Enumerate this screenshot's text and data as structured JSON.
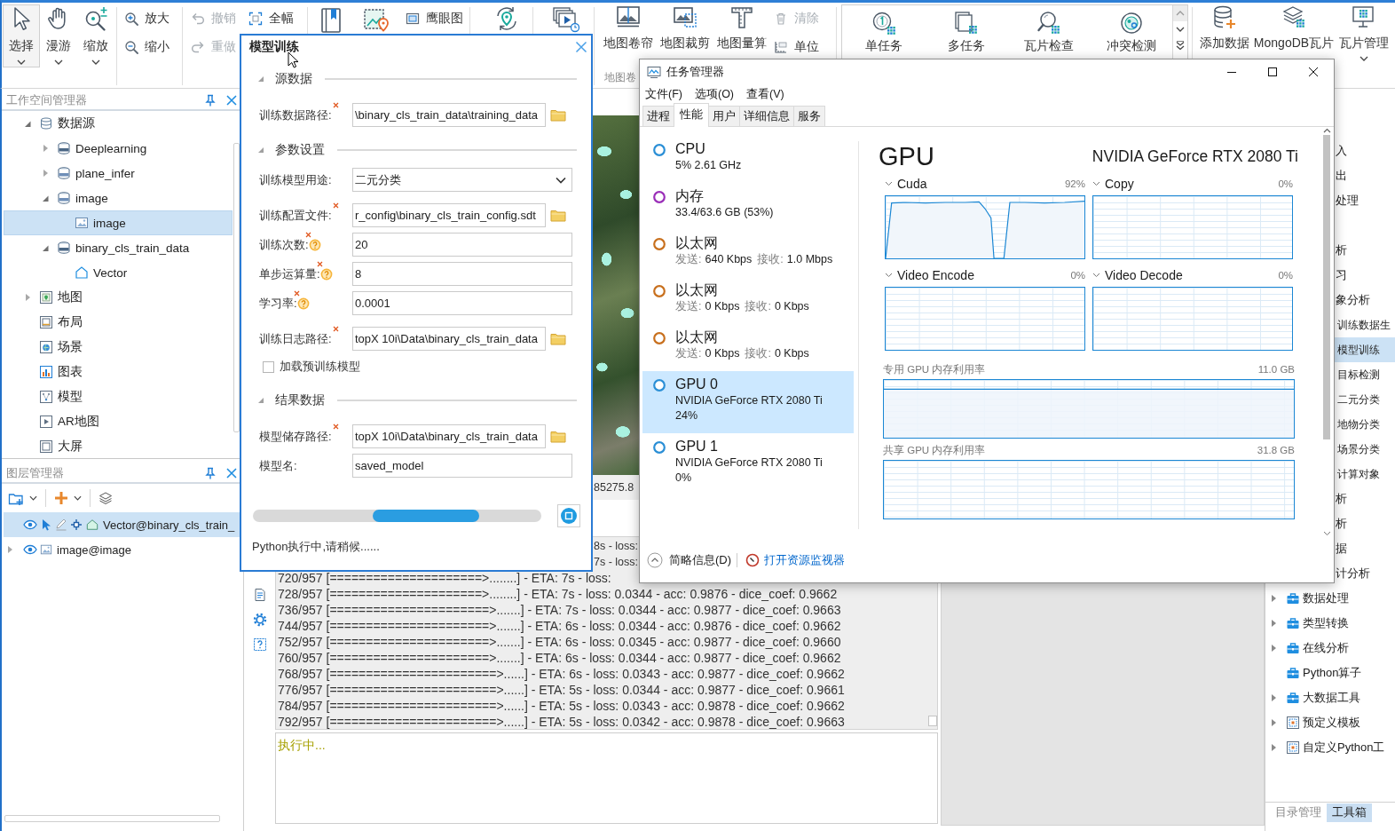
{
  "ribbon": {
    "navigate": [
      {
        "label": "选择",
        "selected": true,
        "dropdown": true
      },
      {
        "label": "漫游",
        "selected": false,
        "dropdown": true
      },
      {
        "label": "缩放",
        "selected": false,
        "dropdown": true
      }
    ],
    "zoom": [
      {
        "label": "放大"
      },
      {
        "label": "缩小"
      }
    ],
    "history": [
      {
        "label": "撤销",
        "disabled": true
      },
      {
        "label": "重做",
        "disabled": true
      }
    ],
    "full_extent": {
      "label": "全幅"
    },
    "overview": {
      "label": "鹰眼图"
    },
    "map_tools": [
      {
        "label": "地图卷帘"
      },
      {
        "label": "地图裁剪"
      },
      {
        "label": "地图量算"
      }
    ],
    "map_small": [
      {
        "label": "清除",
        "disabled": true
      },
      {
        "label": "单位",
        "disabled": false
      }
    ],
    "map_group_label": "地图卷",
    "tile_tasks": [
      {
        "label": "单任务"
      },
      {
        "label": "多任务"
      },
      {
        "label": "瓦片检查"
      },
      {
        "label": "冲突检测"
      }
    ],
    "data_tools": [
      {
        "label": "添加数据",
        "dropdown": false
      },
      {
        "label": "MongoDB瓦片",
        "dropdown": false
      },
      {
        "label": "瓦片管理",
        "dropdown": true
      }
    ]
  },
  "workspace": {
    "title": "工作空间管理器",
    "tree": [
      {
        "label": "数据源",
        "kind": "datasources",
        "expanded": true,
        "selected": false,
        "children": [
          {
            "label": "Deeplearning",
            "kind": "database",
            "expanded": false,
            "selected": false
          },
          {
            "label": "plane_infer",
            "kind": "image-database",
            "expanded": false,
            "selected": false
          },
          {
            "label": "image",
            "kind": "image-database",
            "expanded": true,
            "selected": false,
            "children": [
              {
                "label": "image",
                "kind": "raster",
                "selected": true
              }
            ]
          },
          {
            "label": "binary_cls_train_data",
            "kind": "database",
            "expanded": true,
            "selected": false,
            "children": [
              {
                "label": "Vector",
                "kind": "region",
                "selected": false
              }
            ]
          }
        ]
      },
      {
        "label": "地图",
        "kind": "maps",
        "expanded": false,
        "selected": false
      },
      {
        "label": "布局",
        "kind": "layouts",
        "selected": false
      },
      {
        "label": "场景",
        "kind": "scenes",
        "selected": false
      },
      {
        "label": "图表",
        "kind": "charts",
        "selected": false
      },
      {
        "label": "模型",
        "kind": "models",
        "selected": false
      },
      {
        "label": "AR地图",
        "kind": "ar-maps",
        "selected": false
      },
      {
        "label": "大屏",
        "kind": "screens",
        "selected": false
      }
    ]
  },
  "layers": {
    "title": "图层管理器",
    "items": [
      {
        "label": "Vector@binary_cls_train_",
        "kind": "region",
        "selected": true,
        "visible": true,
        "selectable": true,
        "editable": false,
        "snappable": true
      },
      {
        "label": "image@image",
        "kind": "raster",
        "selected": false,
        "visible": true,
        "expanded": false
      }
    ]
  },
  "dialog": {
    "title": "模型训练",
    "sections": [
      {
        "title": "源数据",
        "expanded": true,
        "fields": [
          {
            "label": "训练数据路径:",
            "kind": "path",
            "required": true,
            "help": false,
            "value": "\\binary_cls_train_data\\training_data"
          }
        ]
      },
      {
        "title": "参数设置",
        "expanded": true,
        "fields": [
          {
            "label": "训练模型用途:",
            "kind": "select",
            "required": false,
            "help": false,
            "value": "二元分类"
          },
          {
            "label": "训练配置文件:",
            "kind": "path",
            "required": true,
            "help": false,
            "value": "r_config\\binary_cls_train_config.sdt"
          },
          {
            "label": "训练次数:",
            "kind": "text",
            "required": true,
            "help": true,
            "value": "20"
          },
          {
            "label": "单步运算量:",
            "kind": "text",
            "required": true,
            "help": true,
            "value": "8"
          },
          {
            "label": "学习率:",
            "kind": "text",
            "required": true,
            "help": true,
            "value": "0.0001"
          },
          {
            "label": "训练日志路径:",
            "kind": "path",
            "required": true,
            "help": false,
            "value": "topX 10i\\Data\\binary_cls_train_data"
          },
          {
            "label": "加载预训练模型",
            "kind": "checkbox",
            "checked": false
          }
        ]
      },
      {
        "title": "结果数据",
        "expanded": true,
        "fields": [
          {
            "label": "模型储存路径:",
            "kind": "path",
            "required": true,
            "help": false,
            "value": "topX 10i\\Data\\binary_cls_train_data"
          },
          {
            "label": "模型名:",
            "kind": "text",
            "required": false,
            "help": false,
            "value": "saved_model"
          }
        ]
      }
    ],
    "progress": {
      "indeterminate": true
    },
    "status": "Python执行中,请稍候......"
  },
  "output": {
    "map_coordinate": "85275.8",
    "log_fragments": [
      "8s - loss:",
      "7s - loss:"
    ],
    "log": [
      "720/957 [=====================>........] - ETA: 7s - loss:",
      "728/957 [=====================>........] - ETA: 7s - loss: 0.0344 - acc: 0.9876 - dice_coef: 0.9662",
      "736/957 [======================>.......] - ETA: 7s - loss: 0.0344 - acc: 0.9877 - dice_coef: 0.9663",
      "744/957 [======================>.......] - ETA: 6s - loss: 0.0344 - acc: 0.9876 - dice_coef: 0.9662",
      "752/957 [======================>.......] - ETA: 6s - loss: 0.0345 - acc: 0.9877 - dice_coef: 0.9660",
      "760/957 [======================>.......] - ETA: 6s - loss: 0.0344 - acc: 0.9877 - dice_coef: 0.9662",
      "768/957 [=======================>......] - ETA: 6s - loss: 0.0343 - acc: 0.9877 - dice_coef: 0.9662",
      "776/957 [=======================>......] - ETA: 5s - loss: 0.0344 - acc: 0.9877 - dice_coef: 0.9661",
      "784/957 [=======================>......] - ETA: 5s - loss: 0.0343 - acc: 0.9878 - dice_coef: 0.9662",
      "792/957 [=======================>......] - ETA: 5s - loss: 0.0342 - acc: 0.9878 - dice_coef: 0.9663"
    ],
    "status": "执行中..."
  },
  "toolbox": {
    "fragments": [
      {
        "label": "入",
        "selected": false
      },
      {
        "label": "出",
        "selected": false
      },
      {
        "label": "处理",
        "selected": false
      },
      {
        "label": "析",
        "selected": false
      },
      {
        "label": "习",
        "selected": false
      },
      {
        "label": "象分析",
        "selected": false,
        "children": [
          {
            "label": "训练数据生",
            "selected": false
          },
          {
            "label": "模型训练",
            "selected": true
          },
          {
            "label": "目标检测",
            "selected": false
          },
          {
            "label": "二元分类",
            "selected": false
          },
          {
            "label": "地物分类",
            "selected": false
          },
          {
            "label": "场景分类",
            "selected": false
          },
          {
            "label": "计算对象",
            "selected": false
          }
        ]
      },
      {
        "label": "析",
        "selected": false
      },
      {
        "label": "析",
        "selected": false
      },
      {
        "label": "据",
        "selected": false
      },
      {
        "label": "计分析",
        "selected": false
      }
    ],
    "items": [
      {
        "label": "数据处理",
        "kind": "folder",
        "expanded": false
      },
      {
        "label": "类型转换",
        "kind": "folder",
        "expanded": false
      },
      {
        "label": "在线分析",
        "kind": "folder",
        "expanded": false
      },
      {
        "label": "Python算子",
        "kind": "folder"
      },
      {
        "label": "大数据工具",
        "kind": "folder",
        "expanded": false
      },
      {
        "label": "预定义模板",
        "kind": "template",
        "expanded": false
      },
      {
        "label": "自定义Python工",
        "kind": "template",
        "expanded": false
      }
    ],
    "tabs": [
      {
        "label": "目录管理",
        "selected": false
      },
      {
        "label": "工具箱",
        "selected": true
      }
    ]
  },
  "task_manager": {
    "title": "任务管理器",
    "menu": [
      "文件(F)",
      "选项(O)",
      "查看(V)"
    ],
    "tabs": [
      {
        "label": "进程",
        "selected": false
      },
      {
        "label": "性能",
        "selected": true
      },
      {
        "label": "用户",
        "selected": false
      },
      {
        "label": "详细信息",
        "selected": false
      },
      {
        "label": "服务",
        "selected": false
      }
    ],
    "devices": [
      {
        "name": "CPU",
        "kind": "device",
        "color": "#2b8fd6",
        "selected": false,
        "lines": [
          "5% 2.61 GHz"
        ]
      },
      {
        "name": "内存",
        "kind": "device",
        "color": "#9a2fb8",
        "selected": false,
        "lines": [
          "33.4/63.6 GB (53%)"
        ]
      },
      {
        "name": "以太网",
        "kind": "network",
        "color": "#c8701e",
        "selected": false,
        "stats": [
          {
            "label": "发送:",
            "value": "640 Kbps"
          },
          {
            "label": "接收:",
            "value": "1.0 Mbps"
          }
        ]
      },
      {
        "name": "以太网",
        "kind": "network",
        "color": "#c8701e",
        "selected": false,
        "stats": [
          {
            "label": "发送:",
            "value": "0 Kbps"
          },
          {
            "label": "接收:",
            "value": "0 Kbps"
          }
        ]
      },
      {
        "name": "以太网",
        "kind": "network",
        "color": "#c8701e",
        "selected": false,
        "stats": [
          {
            "label": "发送:",
            "value": "0 Kbps"
          },
          {
            "label": "接收:",
            "value": "0 Kbps"
          }
        ]
      },
      {
        "name": "GPU 0",
        "kind": "device",
        "color": "#2b8fd6",
        "selected": true,
        "lines": [
          "NVIDIA GeForce RTX 2080 Ti",
          "24%"
        ]
      },
      {
        "name": "GPU 1",
        "kind": "device",
        "color": "#2b8fd6",
        "selected": false,
        "lines": [
          "NVIDIA GeForce RTX 2080 Ti",
          "0%"
        ]
      }
    ],
    "detail": {
      "title": "GPU",
      "model": "NVIDIA GeForce RTX 2080 Ti",
      "engines": [
        {
          "name": "Cuda",
          "reading": "92%",
          "kind": "trace"
        },
        {
          "name": "Copy",
          "reading": "0%",
          "kind": "flat"
        },
        {
          "name": "Video Encode",
          "reading": "0%",
          "kind": "flat"
        },
        {
          "name": "Video Decode",
          "reading": "0%",
          "kind": "flat"
        }
      ],
      "memory": [
        {
          "name": "专用 GPU 内存利用率",
          "reading": "11.0 GB",
          "kind": "filled"
        },
        {
          "name": "共享 GPU 内存利用率",
          "reading": "31.8 GB",
          "kind": "flat"
        }
      ]
    },
    "footer": {
      "summary": "简略信息(D)",
      "link": "打开资源监视器"
    }
  }
}
